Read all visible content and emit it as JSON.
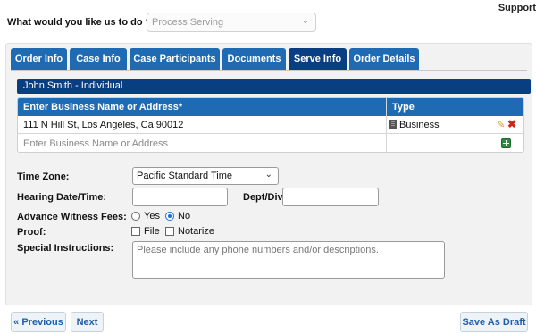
{
  "header": {
    "support_link": "Support",
    "question_label": "What would you like us to do ?",
    "question_select": {
      "value": "Process Serving"
    }
  },
  "tabs": [
    {
      "label": "Order Info",
      "active": false
    },
    {
      "label": "Case Info",
      "active": false
    },
    {
      "label": "Case Participants",
      "active": false
    },
    {
      "label": "Documents",
      "active": false
    },
    {
      "label": "Serve Info",
      "active": true
    },
    {
      "label": "Order Details",
      "active": false
    }
  ],
  "party": {
    "name": "John Smith - Individual"
  },
  "address_table": {
    "columns": [
      "Enter Business Name or Address*",
      "Type"
    ],
    "rows": [
      {
        "address": "111 N Hill St, Los Angeles, Ca 90012",
        "type": "Business",
        "type_icon": "building-icon"
      }
    ],
    "new_row_placeholder": "Enter Business Name or Address"
  },
  "form": {
    "time_zone": {
      "label": "Time Zone:",
      "value": "Pacific Standard Time"
    },
    "hearing": {
      "label": "Hearing Date/Time:",
      "value": ""
    },
    "dept": {
      "label": "Dept/Div:",
      "value": ""
    },
    "witness_fees": {
      "label": "Advance Witness Fees:",
      "options": [
        "Yes",
        "No"
      ],
      "selected": "No"
    },
    "proof": {
      "label": "Proof:",
      "options": [
        "File",
        "Notarize"
      ],
      "checked": []
    },
    "instructions": {
      "label": "Special Instructions:",
      "placeholder": "Please include any phone numbers and/or descriptions."
    }
  },
  "footer": {
    "previous_label": "« Previous",
    "next_label": "Next",
    "save_draft_label": "Save As Draft"
  },
  "colors": {
    "tab_blue": "#1f6bb3",
    "active_navy": "#0a3e82",
    "button_text": "#1f5ea8",
    "delete_red": "#c9261c",
    "add_green": "#2e8b3e"
  }
}
